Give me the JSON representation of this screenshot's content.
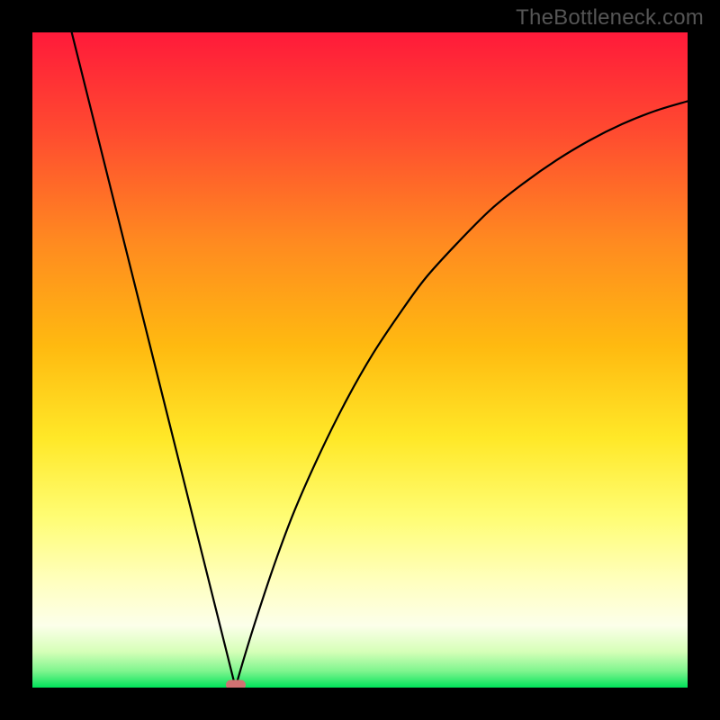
{
  "watermark": "TheBottleneck.com",
  "colors": {
    "curve": "#000000",
    "marker": "#d17272",
    "frame": "#000000"
  },
  "gradient_stops": [
    {
      "offset": 0.0,
      "color": "#ff1a3a"
    },
    {
      "offset": 0.15,
      "color": "#ff4a30"
    },
    {
      "offset": 0.32,
      "color": "#ff8a20"
    },
    {
      "offset": 0.48,
      "color": "#ffba10"
    },
    {
      "offset": 0.62,
      "color": "#ffe828"
    },
    {
      "offset": 0.74,
      "color": "#fffd74"
    },
    {
      "offset": 0.84,
      "color": "#ffffc0"
    },
    {
      "offset": 0.905,
      "color": "#fcffea"
    },
    {
      "offset": 0.945,
      "color": "#d6ffb8"
    },
    {
      "offset": 0.975,
      "color": "#7ef58e"
    },
    {
      "offset": 1.0,
      "color": "#00e35a"
    }
  ],
  "chart_data": {
    "type": "line",
    "title": "",
    "xlabel": "",
    "ylabel": "",
    "xlim": [
      0,
      100
    ],
    "ylim": [
      0,
      100
    ],
    "grid": false,
    "legend": false,
    "series": [
      {
        "name": "bottleneck-curve",
        "minimum_x": 31,
        "points": [
          {
            "x": 6.0,
            "y": 100.0
          },
          {
            "x": 8.0,
            "y": 92.0
          },
          {
            "x": 10.0,
            "y": 84.0
          },
          {
            "x": 12.0,
            "y": 76.0
          },
          {
            "x": 14.0,
            "y": 68.0
          },
          {
            "x": 16.0,
            "y": 60.0
          },
          {
            "x": 18.0,
            "y": 52.0
          },
          {
            "x": 20.0,
            "y": 44.0
          },
          {
            "x": 22.0,
            "y": 36.0
          },
          {
            "x": 24.0,
            "y": 28.0
          },
          {
            "x": 26.0,
            "y": 20.0
          },
          {
            "x": 28.0,
            "y": 12.0
          },
          {
            "x": 30.0,
            "y": 4.0
          },
          {
            "x": 31.0,
            "y": 0.0
          },
          {
            "x": 32.0,
            "y": 3.5
          },
          {
            "x": 34.0,
            "y": 10.0
          },
          {
            "x": 37.0,
            "y": 19.0
          },
          {
            "x": 40.0,
            "y": 27.0
          },
          {
            "x": 44.0,
            "y": 36.0
          },
          {
            "x": 48.0,
            "y": 44.0
          },
          {
            "x": 52.0,
            "y": 51.0
          },
          {
            "x": 56.0,
            "y": 57.0
          },
          {
            "x": 60.0,
            "y": 62.5
          },
          {
            "x": 65.0,
            "y": 68.0
          },
          {
            "x": 70.0,
            "y": 73.0
          },
          {
            "x": 75.0,
            "y": 77.0
          },
          {
            "x": 80.0,
            "y": 80.5
          },
          {
            "x": 85.0,
            "y": 83.5
          },
          {
            "x": 90.0,
            "y": 86.0
          },
          {
            "x": 95.0,
            "y": 88.0
          },
          {
            "x": 100.0,
            "y": 89.5
          }
        ]
      }
    ],
    "marker": {
      "x": 31,
      "y": 0
    }
  }
}
